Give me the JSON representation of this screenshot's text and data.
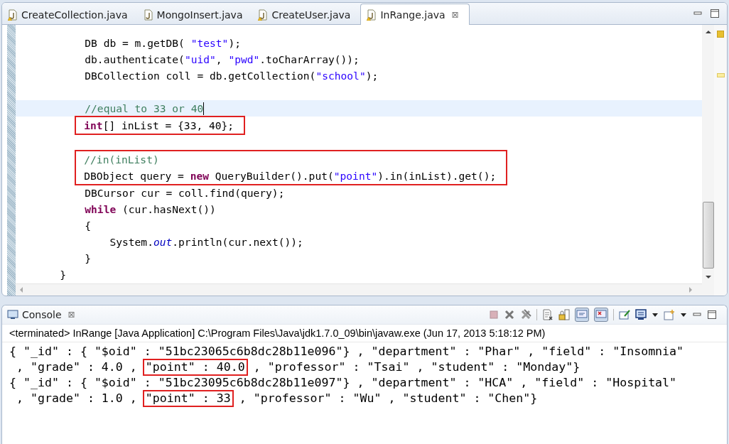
{
  "editor": {
    "tabs": [
      {
        "label": "CreateCollection.java",
        "warning": true,
        "selected": false
      },
      {
        "label": "MongoInsert.java",
        "warning": false,
        "selected": false
      },
      {
        "label": "CreateUser.java",
        "warning": true,
        "selected": false
      },
      {
        "label": "InRange.java",
        "warning": true,
        "selected": true,
        "close": "⊠"
      }
    ],
    "code": [
      {
        "kind": "block",
        "children": [
          {
            "kind": "block",
            "children": [
              {
                "kind": "line",
                "tokens": [
                  {
                    "text": "DB db = m.getDB( ",
                    "kind": "plain"
                  },
                  {
                    "text": "\"test\"",
                    "kind": "string"
                  },
                  {
                    "text": ");",
                    "kind": "plain"
                  }
                ]
              },
              {
                "kind": "line",
                "tokens": [
                  {
                    "text": "db.authenticate(",
                    "kind": "plain"
                  },
                  {
                    "text": "\"uid\"",
                    "kind": "string"
                  },
                  {
                    "text": ", ",
                    "kind": "plain"
                  },
                  {
                    "text": "\"pwd\"",
                    "kind": "string"
                  },
                  {
                    "text": ".toCharArray());",
                    "kind": "plain"
                  }
                ]
              },
              {
                "kind": "line",
                "tokens": [
                  {
                    "text": "DBCollection coll = db.getCollection(",
                    "kind": "plain"
                  },
                  {
                    "text": "\"school\"",
                    "kind": "string"
                  },
                  {
                    "text": ");",
                    "kind": "plain"
                  }
                ]
              },
              {
                "kind": "blank"
              },
              {
                "kind": "line",
                "current": true,
                "tokens": [
                  {
                    "text": "//equal to 33 or 40",
                    "kind": "comment"
                  }
                ]
              },
              {
                "kind": "boxed",
                "lines": [
                  {
                    "tokens": [
                      {
                        "text": "int",
                        "kind": "keyword"
                      },
                      {
                        "text": "[] inList = {33, 40};",
                        "kind": "plain"
                      }
                    ]
                  }
                ]
              },
              {
                "kind": "blank"
              },
              {
                "kind": "boxed",
                "lines": [
                  {
                    "tokens": [
                      {
                        "text": "//in(inList)",
                        "kind": "comment"
                      }
                    ]
                  },
                  {
                    "tokens": [
                      {
                        "text": "DBObject query = ",
                        "kind": "plain"
                      },
                      {
                        "text": "new",
                        "kind": "keyword"
                      },
                      {
                        "text": " QueryBuilder().put(",
                        "kind": "plain"
                      },
                      {
                        "text": "\"point\"",
                        "kind": "string"
                      },
                      {
                        "text": ").in(inList).get();",
                        "kind": "plain"
                      }
                    ]
                  }
                ]
              },
              {
                "kind": "line",
                "tokens": [
                  {
                    "text": "DBCursor cur = coll.find(query);",
                    "kind": "plain"
                  }
                ]
              },
              {
                "kind": "line",
                "tokens": [
                  {
                    "text": "while",
                    "kind": "keyword"
                  },
                  {
                    "text": " (cur.hasNext())",
                    "kind": "plain"
                  }
                ]
              },
              {
                "kind": "line",
                "tokens": [
                  {
                    "text": "{",
                    "kind": "plain"
                  }
                ]
              },
              {
                "kind": "block",
                "children": [
                  {
                    "kind": "line",
                    "tokens": [
                      {
                        "text": "System.",
                        "kind": "plain"
                      },
                      {
                        "text": "out",
                        "kind": "static"
                      },
                      {
                        "text": ".println(cur.next());",
                        "kind": "plain"
                      }
                    ]
                  }
                ]
              },
              {
                "kind": "line",
                "tokens": [
                  {
                    "text": "}",
                    "kind": "plain"
                  }
                ]
              }
            ]
          },
          {
            "kind": "line",
            "tokens": [
              {
                "text": "}",
                "kind": "plain"
              }
            ]
          }
        ]
      }
    ]
  },
  "console": {
    "title": "Console",
    "close": "⊠",
    "status": "<terminated> InRange [Java Application] C:\\Program Files\\Java\\jdk1.7.0_09\\bin\\javaw.exe (Jun 17, 2013 5:18:12 PM)",
    "lines": [
      [
        {
          "text": "{ \"_id\" : { \"$oid\" : \"51bc23065c6b8dc28b11e096\"} , \"department\" : \"Phar\" , \"field\" : \"Insomnia\"",
          "boxed": false
        }
      ],
      [
        {
          "text": " , \"grade\" : 4.0 , ",
          "boxed": false
        },
        {
          "text": "\"point\" : 40.0",
          "boxed": true
        },
        {
          "text": " , \"professor\" : \"Tsai\" , \"student\" : \"Monday\"}",
          "boxed": false
        }
      ],
      [
        {
          "text": "{ \"_id\" : { \"$oid\" : \"51bc23095c6b8dc28b11e097\"} , \"department\" : \"HCA\" , \"field\" : \"Hospital\"",
          "boxed": false
        }
      ],
      [
        {
          "text": " , \"grade\" : 1.0 , ",
          "boxed": false
        },
        {
          "text": "\"point\" : 33",
          "boxed": true
        },
        {
          "text": " , \"professor\" : \"Wu\" , \"student\" : \"Chen\"}",
          "boxed": false
        }
      ]
    ]
  }
}
